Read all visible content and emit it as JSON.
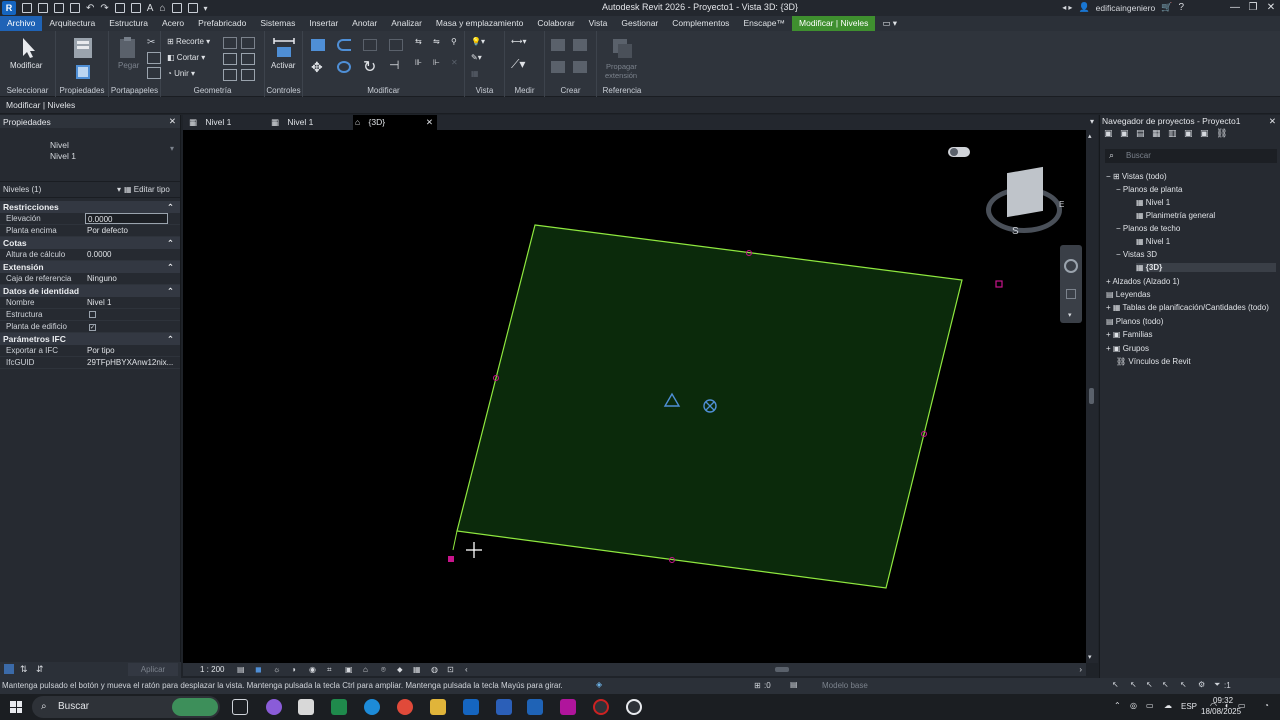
{
  "titlebar": {
    "app_title": "Autodesk Revit 2026 - Proyecto1 - Vista 3D: {3D}",
    "user": "edificaingeniero"
  },
  "menu": {
    "tabs": [
      "Archivo",
      "Arquitectura",
      "Estructura",
      "Acero",
      "Prefabricado",
      "Sistemas",
      "Insertar",
      "Anotar",
      "Analizar",
      "Masa y emplazamiento",
      "Colaborar",
      "Vista",
      "Gestionar",
      "Complementos",
      "Enscape™",
      "Modificar | Niveles"
    ]
  },
  "ribbon": {
    "panels": {
      "select": "Seleccionar",
      "properties": "Propiedades",
      "clipboard": "Portapapeles",
      "geometry": "Geometría",
      "controls": "Controles",
      "modify": "Modificar",
      "view": "Vista",
      "measure": "Medir",
      "create": "Crear",
      "reference": "Referencia"
    },
    "buttons": {
      "modify": "Modificar",
      "paste": "Pegar",
      "cut": "Recorte",
      "cut2": "Cortar",
      "join": "Unir",
      "activate": "Activar",
      "propagate_line1": "Propagar",
      "propagate_line2": "extensión"
    }
  },
  "context_bar": "Modificar | Niveles",
  "properties": {
    "header": "Propiedades",
    "type_family": "Nivel",
    "type_name": "Nivel 1",
    "filter": "Niveles (1)",
    "edit_type": "Editar tipo",
    "groups": [
      {
        "name": "Restricciones",
        "rows": [
          [
            "Elevación",
            "0.0000"
          ],
          [
            "Planta encima",
            "Por defecto"
          ]
        ]
      },
      {
        "name": "Cotas",
        "rows": [
          [
            "Altura de cálculo",
            "0.0000"
          ]
        ]
      },
      {
        "name": "Extensión",
        "rows": [
          [
            "Caja de referencia",
            "Ninguno"
          ]
        ]
      },
      {
        "name": "Datos de identidad",
        "rows": [
          [
            "Nombre",
            "Nivel 1"
          ],
          [
            "Estructura",
            ""
          ],
          [
            "Planta de edificio",
            ""
          ]
        ]
      },
      {
        "name": "Parámetros IFC",
        "rows": [
          [
            "Exportar a IFC",
            "Por tipo"
          ],
          [
            "IfcGUID",
            "29TFpHBYXAnw12nix..."
          ]
        ]
      }
    ],
    "apply": "Aplicar"
  },
  "view_tabs": [
    {
      "label": "Nivel 1"
    },
    {
      "label": "Nivel 1"
    },
    {
      "label": "{3D}",
      "active": true
    }
  ],
  "view_control": {
    "scale": "1 : 200"
  },
  "viewcube": {
    "south": "S",
    "east": "E"
  },
  "browser": {
    "header": "Navegador de proyectos - Proyecto1",
    "search_placeholder": "Buscar",
    "items": [
      "Vistas (todo)",
      "Planos de planta",
      "Nivel 1",
      "Planimetría general",
      "Planos de techo",
      "Nivel 1",
      "Vistas 3D",
      "{3D}",
      "Alzados (Alzado 1)",
      "Leyendas",
      "Tablas de planificación/Cantidades (todo)",
      "Planos (todo)",
      "Familias",
      "Grupos",
      "Vínculos de Revit"
    ]
  },
  "status": {
    "message": "Mantenga pulsado el botón y mueva el ratón para desplazar la vista. Mantenga pulsada la tecla Ctrl para ampliar. Mantenga pulsada la tecla Mayús para girar.",
    "zero": ":0",
    "model": "Modelo base",
    "filter_count": ":1"
  },
  "taskbar": {
    "search": "Buscar",
    "lang": "ESP",
    "time": "09:32",
    "date": "18/08/2025"
  },
  "colors": {
    "level_fill": "#0b2a0b",
    "level_edge": "#8fe83f",
    "grip": "#c8148c",
    "accent": "#1f63b6",
    "context_tab": "#3f8f2f"
  }
}
